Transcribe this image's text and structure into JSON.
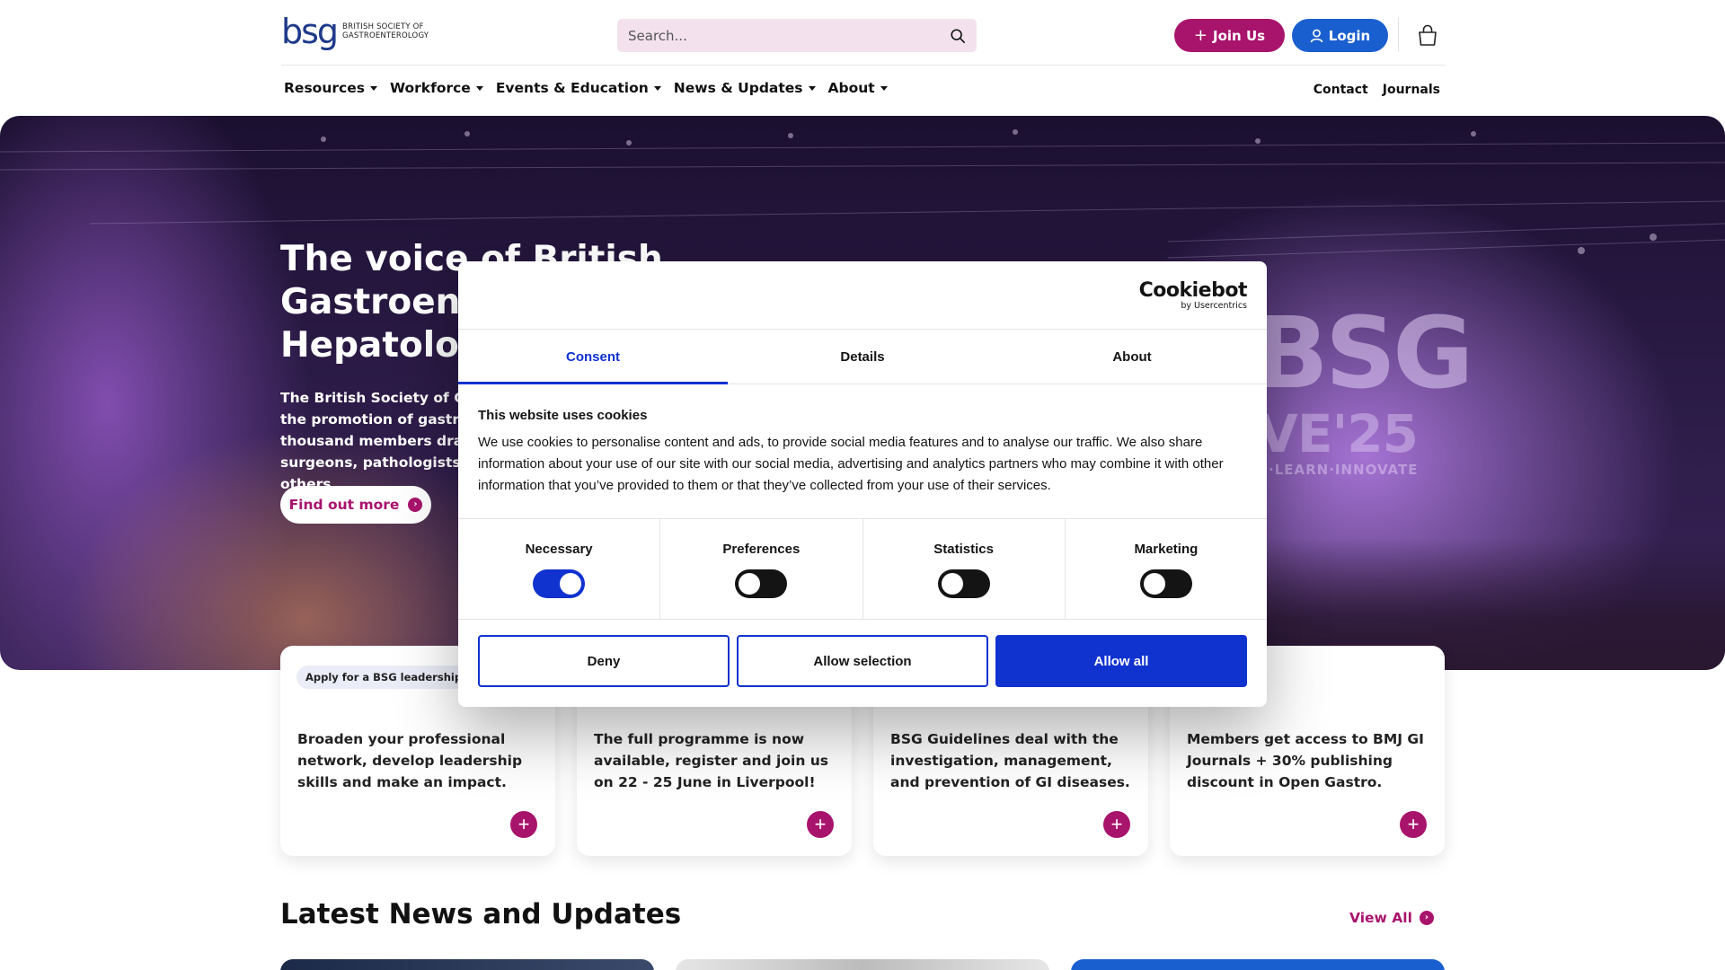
{
  "header": {
    "logo_mark": "bsg",
    "logo_text_line1": "BRITISH SOCIETY OF",
    "logo_text_line2": "GASTROENTEROLOGY",
    "search_placeholder": "Search...",
    "join_label": "Join Us",
    "login_label": "Login",
    "accent_color": "#a8146c",
    "login_color": "#1a5fcf"
  },
  "nav": {
    "items": [
      {
        "label": "Resources"
      },
      {
        "label": "Workforce"
      },
      {
        "label": "Events & Education"
      },
      {
        "label": "News & Updates"
      },
      {
        "label": "About"
      }
    ],
    "right": [
      {
        "label": "Contact"
      },
      {
        "label": "Journals"
      }
    ]
  },
  "hero": {
    "title": "The voice of British Gastroenterology & Hepatology",
    "text": "The British Society of Gastroenterology promotes the promotion of gastroenterology with over thousand members drawn from physicians, surgeons, pathologists, scientists, nurses and others.",
    "button_label": "Find out more",
    "backdrop_big": "BSG",
    "backdrop_small": "VE'25",
    "backdrop_tag": "·LEARN·INNOVATE"
  },
  "cards": [
    {
      "badge": "Apply for a BSG leadership role",
      "text": "Broaden your professional network, develop leadership skills and make an impact."
    },
    {
      "badge": "",
      "text": "The full programme is now available, register and join us on 22 - 25 June in Liverpool!"
    },
    {
      "badge": "",
      "text": "BSG Guidelines deal with the investigation, management, and prevention of GI diseases."
    },
    {
      "badge": "",
      "text": "Members get access to BMJ GI Journals + 30% publishing discount in Open Gastro."
    }
  ],
  "news": {
    "title": "Latest News and Updates",
    "view_all": "View All"
  },
  "cookie_dialog": {
    "brand": "Cookiebot",
    "brand_sub": "by Usercentrics",
    "tabs": [
      {
        "label": "Consent",
        "active": true
      },
      {
        "label": "Details",
        "active": false
      },
      {
        "label": "About",
        "active": false
      }
    ],
    "heading": "This website uses cookies",
    "body": "We use cookies to personalise content and ads, to provide social media features and to analyse our traffic. We also share information about your use of our site with our social media, advertising and analytics partners who may combine it with other information that you’ve provided to them or that they’ve collected from your use of their services.",
    "toggles": [
      {
        "label": "Necessary",
        "on": true
      },
      {
        "label": "Preferences",
        "on": false
      },
      {
        "label": "Statistics",
        "on": false
      },
      {
        "label": "Marketing",
        "on": false
      }
    ],
    "buttons": {
      "deny": "Deny",
      "allow_selection": "Allow selection",
      "allow_all": "Allow all"
    },
    "accent_color": "#1032cf"
  }
}
